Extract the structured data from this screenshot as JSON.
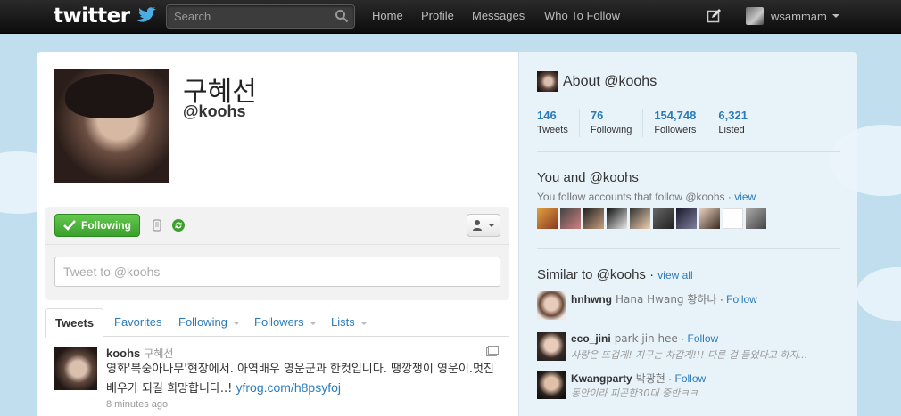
{
  "topbar": {
    "logo_text": "twitter",
    "search_placeholder": "Search",
    "nav": [
      {
        "label": "Home"
      },
      {
        "label": "Profile"
      },
      {
        "label": "Messages"
      },
      {
        "label": "Who To Follow"
      }
    ],
    "username": "wsammam"
  },
  "profile": {
    "name": "구혜선",
    "handle": "@koohs",
    "following_label": "Following",
    "tweet_box_placeholder": "Tweet to @koohs"
  },
  "tabs": [
    {
      "label": "Tweets",
      "active": true
    },
    {
      "label": "Favorites"
    },
    {
      "label": "Following",
      "dropdown": true
    },
    {
      "label": "Followers",
      "dropdown": true
    },
    {
      "label": "Lists",
      "dropdown": true
    }
  ],
  "tweet": {
    "username": "koohs",
    "realname": "구혜선",
    "text": "영화'복숭아나무'현장에서. 아역배우 영운군과 한컷입니다. 땡깡쟁이 영운이.멋진 배우가 되길 희망합니다..! ",
    "link": "yfrog.com/h8psyfoj",
    "time": "8 minutes ago"
  },
  "about": {
    "title": "About @koohs",
    "stats": [
      {
        "value": "146",
        "label": "Tweets"
      },
      {
        "value": "76",
        "label": "Following"
      },
      {
        "value": "154,748",
        "label": "Followers"
      },
      {
        "value": "6,321",
        "label": "Listed"
      }
    ]
  },
  "you_and": {
    "title": "You and @koohs",
    "subtitle": "You follow accounts that follow @koohs · ",
    "view": "view"
  },
  "similar": {
    "title": "Similar to @koohs",
    "view_all": "view all",
    "users": [
      {
        "username": "hnhwng",
        "realname": "Hana Hwang 황하나",
        "follow": "Follow",
        "snippet": ""
      },
      {
        "username": "eco_jini",
        "realname": "park jin hee",
        "follow": "Follow",
        "snippet": "사랑은 뜨겁게! 지구는 차갑게!!! 다른 걸 들었다고 하지..."
      },
      {
        "username": "Kwangparty",
        "realname": "박광현",
        "follow": "Follow",
        "snippet": "동안이라 피곤한30대 중반ㅋㅋ"
      }
    ]
  },
  "colors": {
    "link": "#2b7bb9",
    "follow_green": "#3b9f2c",
    "topbar": "#1a1a1a",
    "background": "#c0deed"
  }
}
